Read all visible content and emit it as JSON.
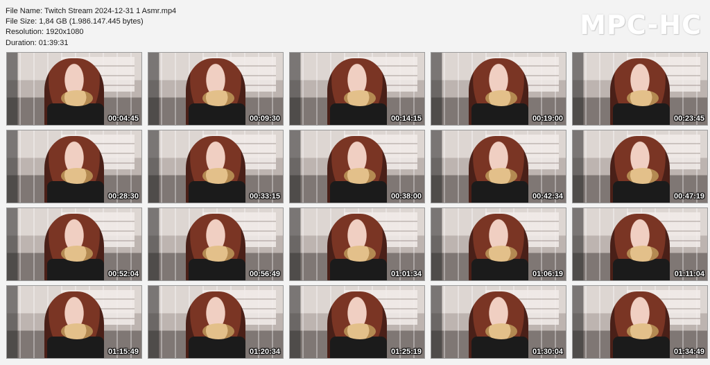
{
  "file_info": {
    "name_line": "File Name: Twitch Stream 2024-12-31 1 Asmr.mp4",
    "size_line": "File Size: 1,84 GB (1.986.147.445 bytes)",
    "resolution_line": "Resolution: 1920x1080",
    "duration_line": "Duration: 01:39:31"
  },
  "logo": "MPC-HC",
  "thumbnails": [
    {
      "timestamp": "00:04:45"
    },
    {
      "timestamp": "00:09:30"
    },
    {
      "timestamp": "00:14:15"
    },
    {
      "timestamp": "00:19:00"
    },
    {
      "timestamp": "00:23:45"
    },
    {
      "timestamp": "00:28:30"
    },
    {
      "timestamp": "00:33:15"
    },
    {
      "timestamp": "00:38:00"
    },
    {
      "timestamp": "00:42:34"
    },
    {
      "timestamp": "00:47:19"
    },
    {
      "timestamp": "00:52:04"
    },
    {
      "timestamp": "00:56:49"
    },
    {
      "timestamp": "01:01:34"
    },
    {
      "timestamp": "01:06:19"
    },
    {
      "timestamp": "01:11:04"
    },
    {
      "timestamp": "01:15:49"
    },
    {
      "timestamp": "01:20:34"
    },
    {
      "timestamp": "01:25:19"
    },
    {
      "timestamp": "01:30:04"
    },
    {
      "timestamp": "01:34:49"
    }
  ]
}
